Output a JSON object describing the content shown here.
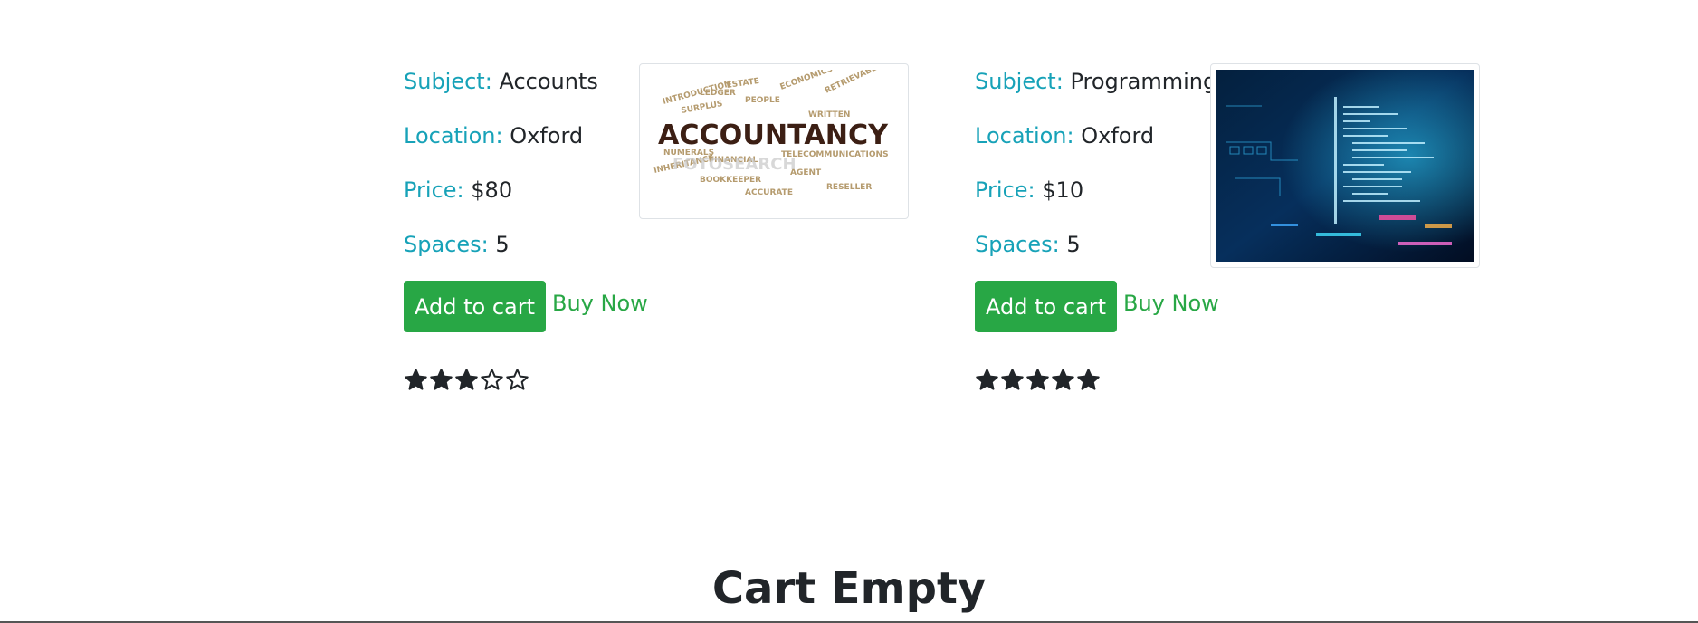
{
  "lessons": [
    {
      "subject_label": "Subject:",
      "subject": "Accounts",
      "location_label": "Location:",
      "location": "Oxford",
      "price_label": "Price:",
      "price": "$80",
      "spaces_label": "Spaces:",
      "spaces": "5",
      "image": "accountancy-word-cloud-image",
      "image_word": "ACCOUNTANCY",
      "add_label": "Add to cart",
      "buy_label": "Buy Now",
      "rating": 3,
      "rating_max": 5
    },
    {
      "subject_label": "Subject:",
      "subject": "Programming",
      "location_label": "Location:",
      "location": "Oxford",
      "price_label": "Price:",
      "price": "$10",
      "spaces_label": "Spaces:",
      "spaces": "5",
      "image": "programming-code-screen-image",
      "add_label": "Add to cart",
      "buy_label": "Buy Now",
      "rating": 5,
      "rating_max": 5
    }
  ],
  "cart": {
    "status": "Cart Empty"
  },
  "colors": {
    "label": "#17a2b8",
    "button": "#28a745",
    "link": "#28a745",
    "star": "#212529"
  }
}
